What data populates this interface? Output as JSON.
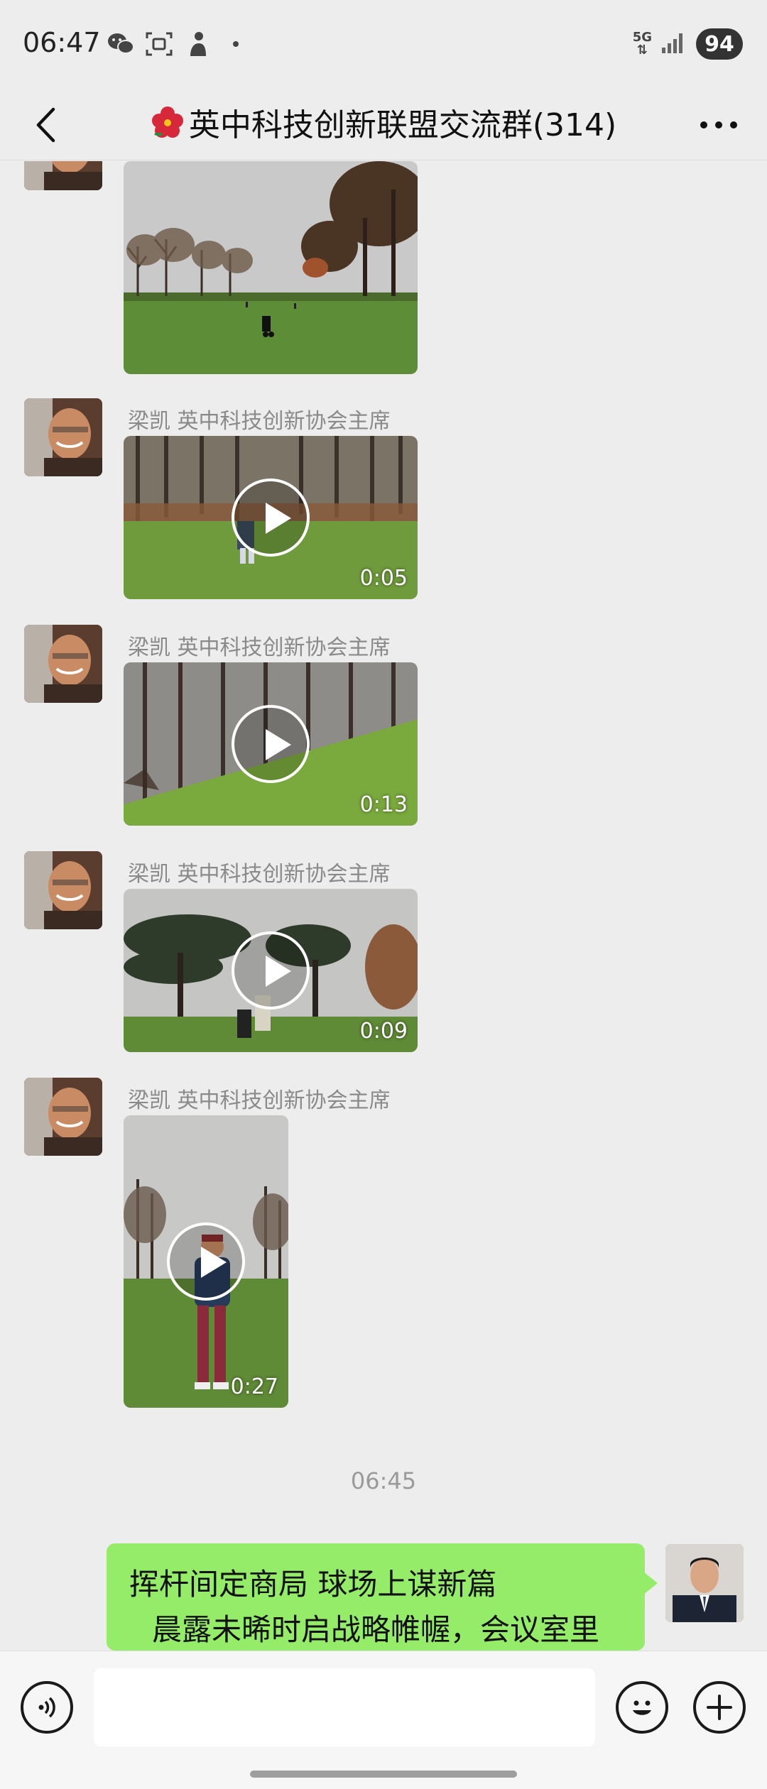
{
  "status_bar": {
    "time": "06:47",
    "left_icons": [
      "wechat-icon",
      "scan-icon",
      "pet-icon",
      "dot-icon"
    ],
    "network": "5G",
    "battery": "94"
  },
  "nav": {
    "back_icon": "chevron-left-icon",
    "title_emoji_icon": "hibiscus-icon",
    "title": "英中科技创新联盟交流群(314)",
    "more_icon": "more-dots-icon"
  },
  "messages": [
    {
      "sender": "",
      "type": "image",
      "scene": "park-lawn"
    },
    {
      "sender": "梁凯 英中科技创新协会主席",
      "type": "video",
      "duration": "0:05",
      "scene": "golf-swing-forest"
    },
    {
      "sender": "梁凯 英中科技创新协会主席",
      "type": "video",
      "duration": "0:13",
      "scene": "slope-forest"
    },
    {
      "sender": "梁凯 英中科技创新协会主席",
      "type": "video",
      "duration": "0:09",
      "scene": "cedar-trees"
    },
    {
      "sender": "梁凯 英中科技创新协会主席",
      "type": "video",
      "duration": "0:27",
      "scene": "golfer-standing"
    }
  ],
  "time_divider": "06:45",
  "my_message": {
    "line1": "挥杆间定商局 球场上谋新篇",
    "line2": "晨露未晞时启战略帷幄，会议室里"
  },
  "input_bar": {
    "voice_icon": "voice-icon",
    "text_value": "",
    "emoji_icon": "emoji-icon",
    "plus_icon": "plus-icon"
  },
  "colors": {
    "background": "#ededed",
    "my_bubble": "#95ec69",
    "sender_name": "#8a8a8a"
  }
}
